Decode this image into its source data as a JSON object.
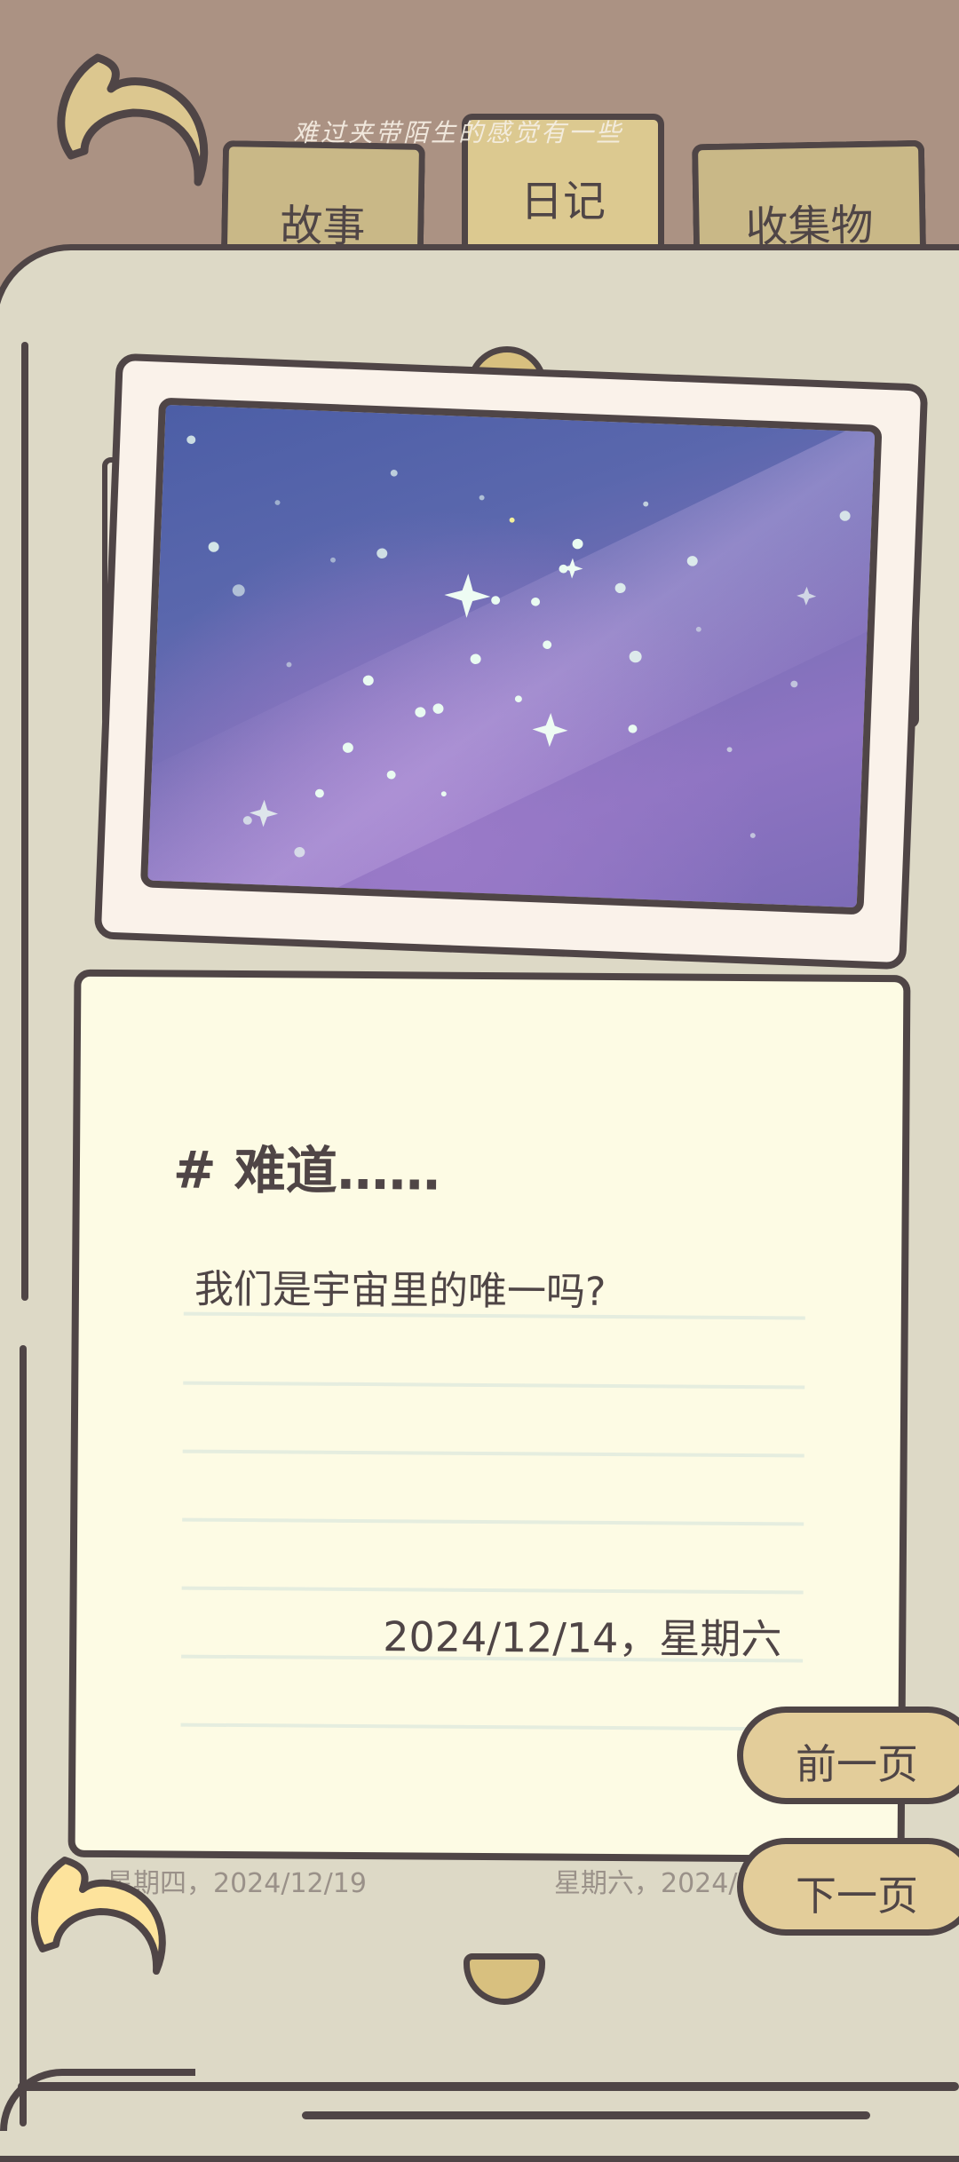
{
  "tabs": {
    "caption": "难过夹带陌生的感觉有一些",
    "story": "故事",
    "diary": "日记",
    "collection": "收集物"
  },
  "entry": {
    "title": "# 难道……",
    "text": "我们是宇宙里的唯一吗?",
    "date": "2024/12/14，星期六"
  },
  "neighbors": {
    "previous": "星期四，2024/12/19",
    "next": "星期六，2024/"
  },
  "nav": {
    "prev_label": "前一页",
    "next_label": "下一页"
  },
  "colors": {
    "outline": "#4f4546",
    "page": "#ddd9c6",
    "card": "#fdfbe4",
    "tab": "#c9b887",
    "button": "#e3cd9a",
    "background": "#ab9283"
  },
  "icons": {
    "back": "back-arrow-icon",
    "corner": "corner-arrow-icon"
  }
}
